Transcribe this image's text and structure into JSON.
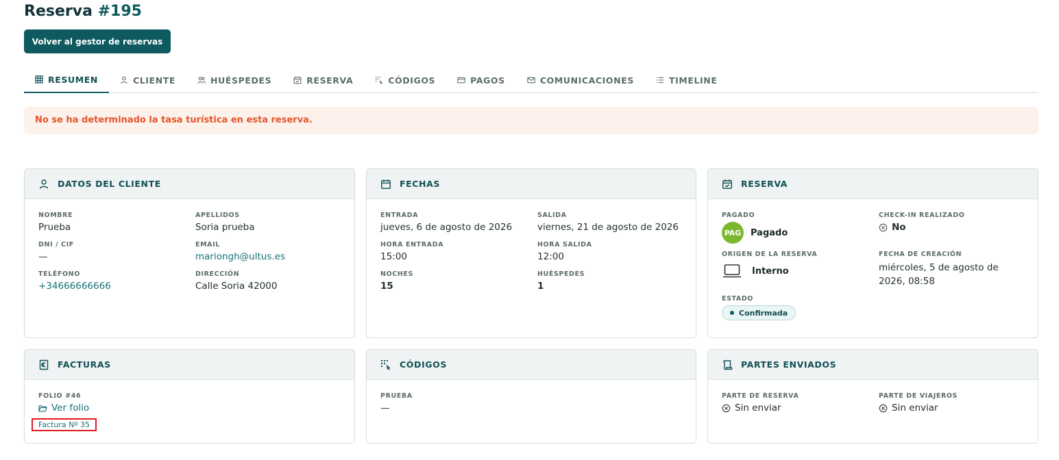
{
  "page": {
    "title_prefix": "Reserva",
    "title_number": "#195",
    "back_button": "Volver al gestor de reservas"
  },
  "tabs": [
    {
      "label": "RESUMEN",
      "icon": "grid-icon",
      "active": true
    },
    {
      "label": "CLIENTE",
      "icon": "user-icon",
      "active": false
    },
    {
      "label": "HUÉSPEDES",
      "icon": "users-icon",
      "active": false
    },
    {
      "label": "RESERVA",
      "icon": "calendar-check-icon",
      "active": false
    },
    {
      "label": "CÓDIGOS",
      "icon": "code-icon",
      "active": false
    },
    {
      "label": "PAGOS",
      "icon": "credit-card-icon",
      "active": false
    },
    {
      "label": "COMUNICACIONES",
      "icon": "mail-icon",
      "active": false
    },
    {
      "label": "TIMELINE",
      "icon": "list-icon",
      "active": false
    }
  ],
  "alert": {
    "text": "No se ha determinado la tasa turística en esta reserva.",
    "color": "#e2562b"
  },
  "cliente": {
    "title": "DATOS DEL CLIENTE",
    "nombre_label": "NOMBRE",
    "nombre": "Prueba",
    "apellidos_label": "APELLIDOS",
    "apellidos": "Soria prueba",
    "dni_label": "DNI / CIF",
    "dni": "—",
    "email_label": "EMAIL",
    "email": "mariongh@ultus.es",
    "telefono_label": "TELÉFONO",
    "telefono": "+34666666666",
    "direccion_label": "DIRECCIÓN",
    "direccion": "Calle Soria 42000"
  },
  "fechas": {
    "title": "FECHAS",
    "entrada_label": "ENTRADA",
    "entrada": "jueves, 6 de agosto de 2026",
    "salida_label": "SALIDA",
    "salida": "viernes, 21 de agosto de 2026",
    "hora_entrada_label": "HORA ENTRADA",
    "hora_entrada": "15:00",
    "hora_salida_label": "HORA SALIDA",
    "hora_salida": "12:00",
    "noches_label": "NOCHES",
    "noches": "15",
    "huespedes_label": "HUÉSPEDES",
    "huespedes": "1"
  },
  "reserva": {
    "title": "RESERVA",
    "pagado_label": "PAGADO",
    "pagado_badge": "PAG",
    "pagado": "Pagado",
    "checkin_label": "CHECK-IN REALIZADO",
    "checkin": "No",
    "origen_label": "ORIGEN DE LA RESERVA",
    "origen": "Interno",
    "fecha_creacion_label": "FECHA DE CREACIÓN",
    "fecha_creacion": "miércoles, 5 de agosto de 2026, 08:58",
    "estado_label": "ESTADO",
    "estado": "Confirmada"
  },
  "facturas": {
    "title": "FACTURAS",
    "folio_label": "FOLIO #46",
    "ver_folio": "Ver folio",
    "factura_link": "Factura Nº 35"
  },
  "codigos": {
    "title": "CÓDIGOS",
    "prueba_label": "PRUEBA",
    "prueba": "—"
  },
  "partes": {
    "title": "PARTES ENVIADOS",
    "reserva_label": "PARTE DE RESERVA",
    "reserva": "Sin enviar",
    "viajeros_label": "PARTE DE VIAJEROS",
    "viajeros": "Sin enviar"
  },
  "colors": {
    "primary": "#0e5a60",
    "paid_green": "#7cb82f",
    "highlight_red": "#e0191f"
  }
}
